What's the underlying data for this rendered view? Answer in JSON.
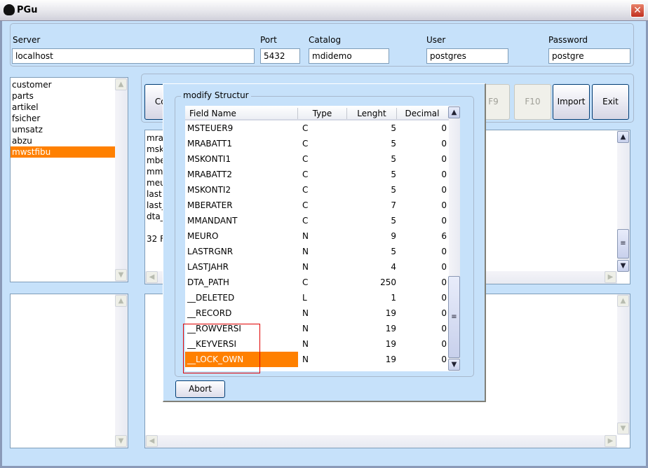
{
  "window": {
    "title": "PGu",
    "close_label": "✕"
  },
  "connection": {
    "server_label": "Server",
    "server_value": "localhost",
    "port_label": "Port",
    "port_value": "5432",
    "catalog_label": "Catalog",
    "catalog_value": "mdidemo",
    "user_label": "User",
    "user_value": "postgres",
    "password_label": "Password",
    "password_value": "postgre"
  },
  "tables": {
    "items": [
      "customer",
      "parts",
      "artikel",
      "fsicher",
      "umsatz",
      "abzu",
      "mwstfibu"
    ],
    "selected": "mwstfibu"
  },
  "toolbar": {
    "connect_label": "Con",
    "f9_label": "F9",
    "f10_label": "F10",
    "import_label": "Import",
    "exit_label": "Exit"
  },
  "output": {
    "lines": [
      "mra",
      "msk",
      "mbe",
      "mm",
      "meu",
      "last",
      "last_",
      "dta_",
      "",
      "32 F"
    ]
  },
  "dialog": {
    "group_title": "modify Structur",
    "columns": [
      "Field Name",
      "Type",
      "Lenght",
      "Decimal"
    ],
    "rows": [
      [
        "MSTEUER9",
        "C",
        "5",
        "0"
      ],
      [
        "MRABATT1",
        "C",
        "5",
        "0"
      ],
      [
        "MSKONTI1",
        "C",
        "5",
        "0"
      ],
      [
        "MRABATT2",
        "C",
        "5",
        "0"
      ],
      [
        "MSKONTI2",
        "C",
        "5",
        "0"
      ],
      [
        "MBERATER",
        "C",
        "7",
        "0"
      ],
      [
        "MMANDANT",
        "C",
        "5",
        "0"
      ],
      [
        "MEURO",
        "N",
        "9",
        "6"
      ],
      [
        "LASTRGNR",
        "N",
        "5",
        "0"
      ],
      [
        "LASTJAHR",
        "N",
        "4",
        "0"
      ],
      [
        "DTA_PATH",
        "C",
        "250",
        "0"
      ],
      [
        "__DELETED",
        "L",
        "1",
        "0"
      ],
      [
        "__RECORD",
        "N",
        "19",
        "0"
      ],
      [
        "__ROWVERSI",
        "N",
        "19",
        "0"
      ],
      [
        "__KEYVERSI",
        "N",
        "19",
        "0"
      ],
      [
        "__LOCK_OWN",
        "N",
        "19",
        "0"
      ]
    ],
    "selected_row": "__LOCK_OWN",
    "abort_label": "Abort"
  },
  "colors": {
    "selection": "#ff8000",
    "background": "#c6e1fa",
    "highlight_box": "#e00000"
  }
}
